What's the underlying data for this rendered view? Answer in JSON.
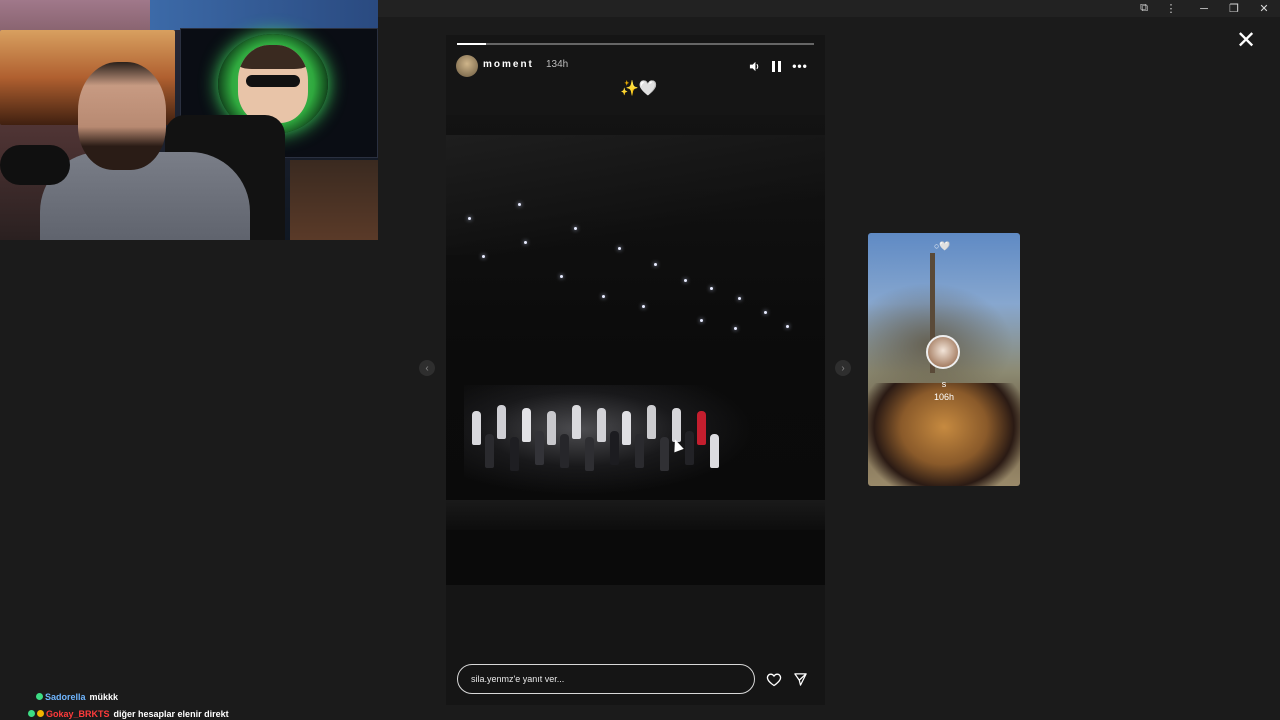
{
  "window": {
    "extension_icon": "puzzle-icon",
    "menu_icon": "kebab-icon",
    "min_label": "─",
    "restore_label": "❐",
    "close_label": "✕"
  },
  "story": {
    "username": "moment",
    "age": "134h",
    "sticker": "✨🤍",
    "reply_placeholder": "sila.yenmz'e yanıt ver...",
    "progress": 0.08,
    "icons": {
      "mute": "speaker-icon",
      "pause": "pause-icon",
      "more": "more-icon",
      "like": "heart-icon",
      "send": "send-icon"
    }
  },
  "navigation": {
    "prev_label": "‹",
    "next_label": "›",
    "close_label": "✕"
  },
  "next_story": {
    "sticker": "○🤍",
    "name": "s",
    "age": "106h"
  },
  "chat": {
    "messages": [
      {
        "user": "Sadorella",
        "user_color": "#6fb6ff",
        "text": "mükkk"
      },
      {
        "user": "Gokay_BRKTS",
        "user_color": "#ff3b3b",
        "text": "diğer hesaplar elenir direkt"
      }
    ]
  }
}
